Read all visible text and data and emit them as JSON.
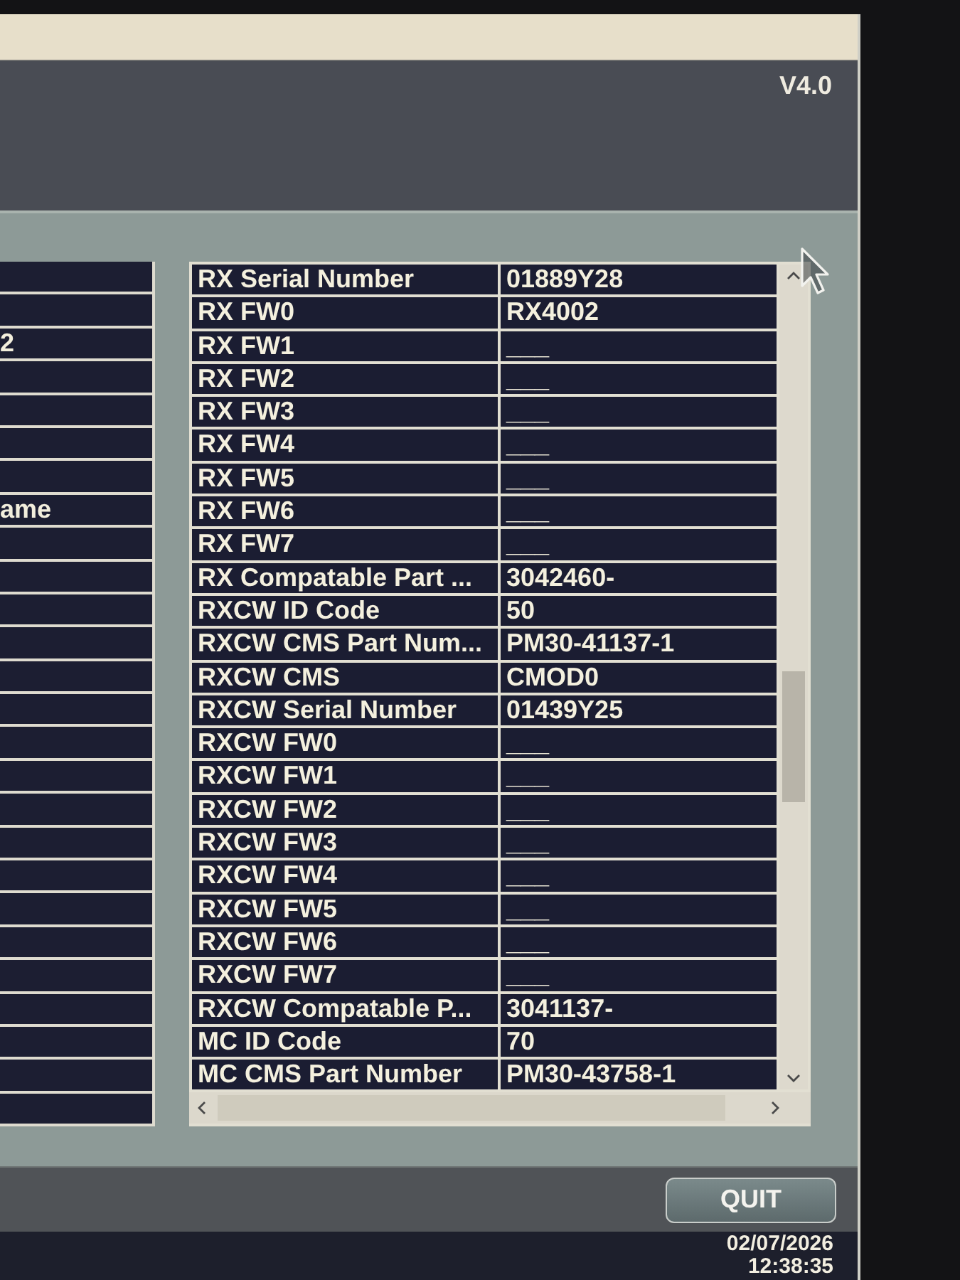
{
  "header": {
    "version": "V4.0"
  },
  "left_table": {
    "rows": [
      {},
      {},
      {
        "cell": "2"
      },
      {},
      {},
      {},
      {},
      {
        "cell": "ame"
      },
      {},
      {},
      {},
      {},
      {},
      {},
      {},
      {},
      {},
      {},
      {},
      {},
      {},
      {},
      {},
      {},
      {},
      {}
    ]
  },
  "parameter_table": {
    "rows": [
      {
        "label": "RX Serial Number",
        "value": "01889Y28"
      },
      {
        "label": "RX FW0",
        "value": "RX4002"
      },
      {
        "label": "RX FW1",
        "value": "___"
      },
      {
        "label": "RX FW2",
        "value": "___"
      },
      {
        "label": "RX FW3",
        "value": "___"
      },
      {
        "label": "RX FW4",
        "value": "___"
      },
      {
        "label": "RX FW5",
        "value": "___"
      },
      {
        "label": "RX FW6",
        "value": "___"
      },
      {
        "label": "RX FW7",
        "value": "___"
      },
      {
        "label": "RX Compatable Part ...",
        "value": "3042460-"
      },
      {
        "label": "RXCW ID Code",
        "value": "50"
      },
      {
        "label": "RXCW CMS Part Num...",
        "value": "PM30-41137-1"
      },
      {
        "label": "RXCW CMS",
        "value": "CMOD0"
      },
      {
        "label": "RXCW Serial Number",
        "value": "01439Y25"
      },
      {
        "label": "RXCW FW0",
        "value": "___"
      },
      {
        "label": "RXCW FW1",
        "value": "___"
      },
      {
        "label": "RXCW FW2",
        "value": "___"
      },
      {
        "label": "RXCW FW3",
        "value": "___"
      },
      {
        "label": "RXCW FW4",
        "value": "___"
      },
      {
        "label": "RXCW FW5",
        "value": "___"
      },
      {
        "label": "RXCW FW6",
        "value": "___"
      },
      {
        "label": "RXCW FW7",
        "value": "___"
      },
      {
        "label": "RXCW Compatable P...",
        "value": "3041137-"
      },
      {
        "label": "MC ID Code",
        "value": "70"
      },
      {
        "label": "MC CMS Part Number",
        "value": "PM30-43758-1"
      }
    ]
  },
  "footer": {
    "quit_button": "QUIT",
    "date": "02/07/2026",
    "time": "12:38:35"
  }
}
